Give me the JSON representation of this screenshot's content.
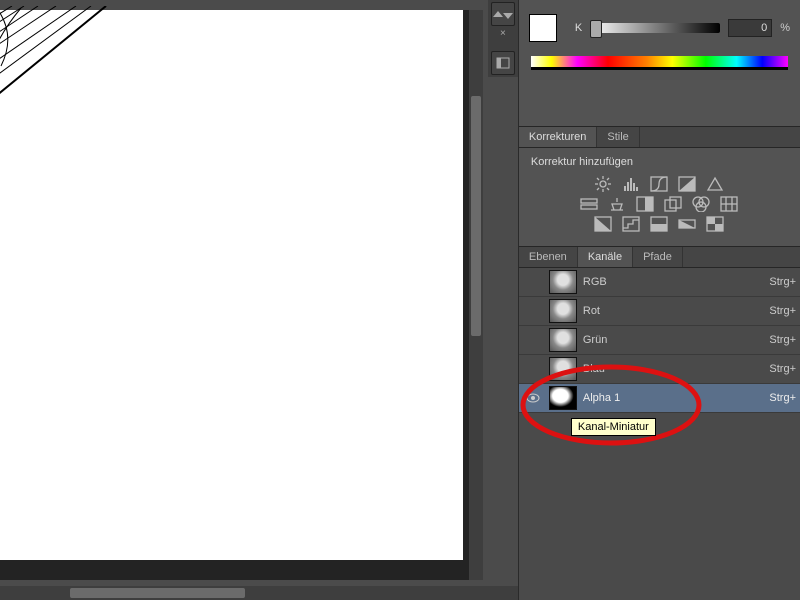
{
  "color_picker": {
    "label": "K",
    "value": "0",
    "suffix": "%"
  },
  "adjustments": {
    "tabs": {
      "korrekturen": "Korrekturen",
      "stile": "Stile"
    },
    "title": "Korrektur hinzufügen"
  },
  "layers": {
    "tabs": {
      "ebenen": "Ebenen",
      "kanaele": "Kanäle",
      "pfade": "Pfade"
    },
    "channels": [
      {
        "name": "RGB",
        "shortcut": "Strg+",
        "visible": false
      },
      {
        "name": "Rot",
        "shortcut": "Strg+",
        "visible": false
      },
      {
        "name": "Grün",
        "shortcut": "Strg+",
        "visible": false
      },
      {
        "name": "Blau",
        "shortcut": "Strg+",
        "visible": false
      },
      {
        "name": "Alpha 1",
        "shortcut": "Strg+",
        "visible": true,
        "selected": true,
        "alpha": true
      }
    ]
  },
  "tooltip": "Kanal-Miniatur"
}
